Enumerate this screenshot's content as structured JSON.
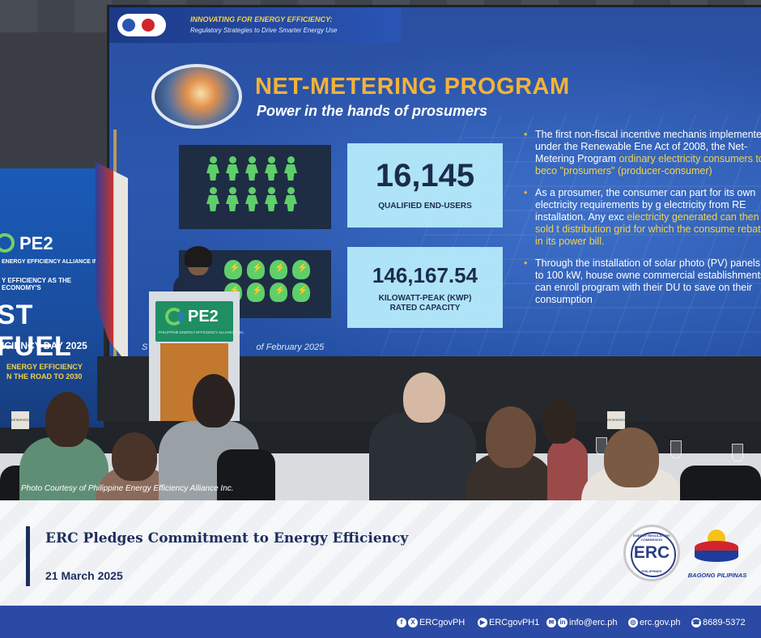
{
  "slide": {
    "header_line1": "INNOVATING FOR ENERGY EFFICIENCY:",
    "header_line2": "Regulatory Strategies to Drive Smarter Energy Use",
    "title": "NET-METERING PROGRAM",
    "subtitle": "Power in the hands of prosumers",
    "stat1": {
      "value": "16,145",
      "label": "QUALIFIED END-USERS"
    },
    "stat2": {
      "value": "146,167.54",
      "label_line1": "KILOWATT-PEAK (KWP)",
      "label_line2": "RATED CAPACITY"
    },
    "bullets": [
      {
        "text": "The first non-fiscal incentive mechanis implemented under the Renewable Ene Act of 2008, the Net-Metering Program",
        "highlight": "ordinary electricity consumers to beco \"prosumers\" (producer-consumer)"
      },
      {
        "text": "As a prosumer, the consumer can part for its own electricity requirements by g electricity from RE installation. Any exc",
        "highlight": "electricity generated can then be sold t distribution grid for which the consume rebates in its power bill."
      },
      {
        "text": "Through the installation of solar photo (PV) panels up to 100 kW, house owne commercial establishments can enroll program with their DU to save on their consumption",
        "highlight": ""
      }
    ],
    "footnote": "of February 2025",
    "footnote_prefix": "S"
  },
  "banner": {
    "pe2": "PE2",
    "small_line1": "ENERGY EFFICIENCY ALLIANCE INC.",
    "small_line2": "Y EFFICIENCY AS THE ECONOMY'S",
    "big": "ST FUEL",
    "mid": "ICIENCY DAY 2025",
    "yl_line1": "ENERGY EFFICIENCY",
    "yl_line2": "N THE ROAD TO 2030"
  },
  "podium": {
    "pe2": "PE2",
    "tag": "PHILIPPINE ENERGY EFFICIENCY ALLIANCE INC."
  },
  "reserved_label": "RESERVED",
  "photo_credit": "Photo Courtesy of Philippine Energy Efficiency Alliance Inc.",
  "article": {
    "headline": "ERC Pledges Commitment to Energy Efficiency",
    "date": "21 March 2025"
  },
  "logos": {
    "erc": "ERC",
    "erc_ring": "ENERGY REGULATORY COMMISSION",
    "erc_bottom": "PHILIPPINES",
    "bagong_pilipinas": "BAGONG PILIPINAS"
  },
  "footer": {
    "social1": "ERCgovPH",
    "social2": "ERCgovPH1",
    "email": "info@erc.ph",
    "web": "erc.gov.ph",
    "phone": "8689-5372",
    "icons": [
      "facebook-icon",
      "x-icon",
      "youtube-icon",
      "email-icon",
      "linkedin-icon",
      "globe-icon",
      "phone-icon"
    ]
  },
  "colors": {
    "navy": "#1c2e5c",
    "footer_blue": "#2b4aa5",
    "slide_orange": "#f3b23a",
    "slide_green": "#5fcf6a"
  }
}
